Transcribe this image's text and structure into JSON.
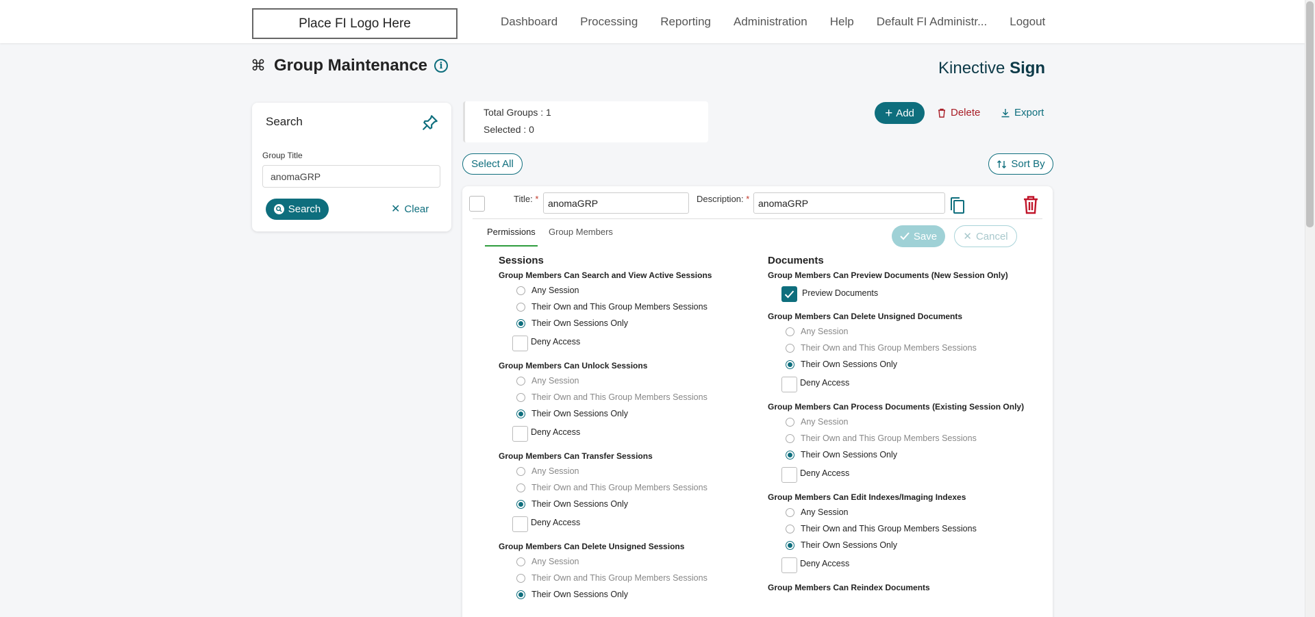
{
  "header": {
    "logo_text": "Place FI Logo Here",
    "nav": [
      "Dashboard",
      "Processing",
      "Reporting",
      "Administration",
      "Help",
      "Default FI Administr...",
      "Logout"
    ]
  },
  "page": {
    "title": "Group Maintenance",
    "brand_light": "Kinective ",
    "brand_bold": "Sign"
  },
  "search": {
    "title": "Search",
    "group_title_label": "Group Title",
    "group_title_value": "anomaGRP",
    "search_label": "Search",
    "clear_label": "Clear"
  },
  "stats": {
    "total_groups": "Total Groups : 1",
    "selected": "Selected : 0"
  },
  "toolbar": {
    "add_label": "Add",
    "delete_label": "Delete",
    "export_label": "Export",
    "select_all_label": "Select All",
    "sort_by_label": "Sort By"
  },
  "group": {
    "title_label": "Title:",
    "title_value": "anomaGRP",
    "description_label": "Description:",
    "description_value": "anomaGRP",
    "required_mark": "*",
    "tabs": [
      "Permissions",
      "Group Members"
    ],
    "save_label": "Save",
    "cancel_label": "Cancel"
  },
  "options": {
    "any": "Any Session",
    "own_group": "Their Own and This Group Members Sessions",
    "own_only": "Their Own Sessions Only",
    "deny": "Deny Access"
  },
  "sessions": {
    "heading": "Sessions",
    "perms": [
      "Group Members Can Search and View Active Sessions",
      "Group Members Can Unlock Sessions",
      "Group Members Can Transfer Sessions",
      "Group Members Can Delete Unsigned Sessions"
    ]
  },
  "documents": {
    "heading": "Documents",
    "preview_title": "Group Members Can Preview Documents (New Session Only)",
    "preview_label": "Preview Documents",
    "perms": [
      "Group Members Can Delete Unsigned Documents",
      "Group Members Can Process Documents (Existing Session Only)",
      "Group Members Can Edit Indexes/Imaging Indexes",
      "Group Members Can Reindex Documents"
    ]
  },
  "colors": {
    "accent": "#0e6e7d",
    "danger": "#a81c25",
    "tab_underline": "#2e9c3d"
  }
}
